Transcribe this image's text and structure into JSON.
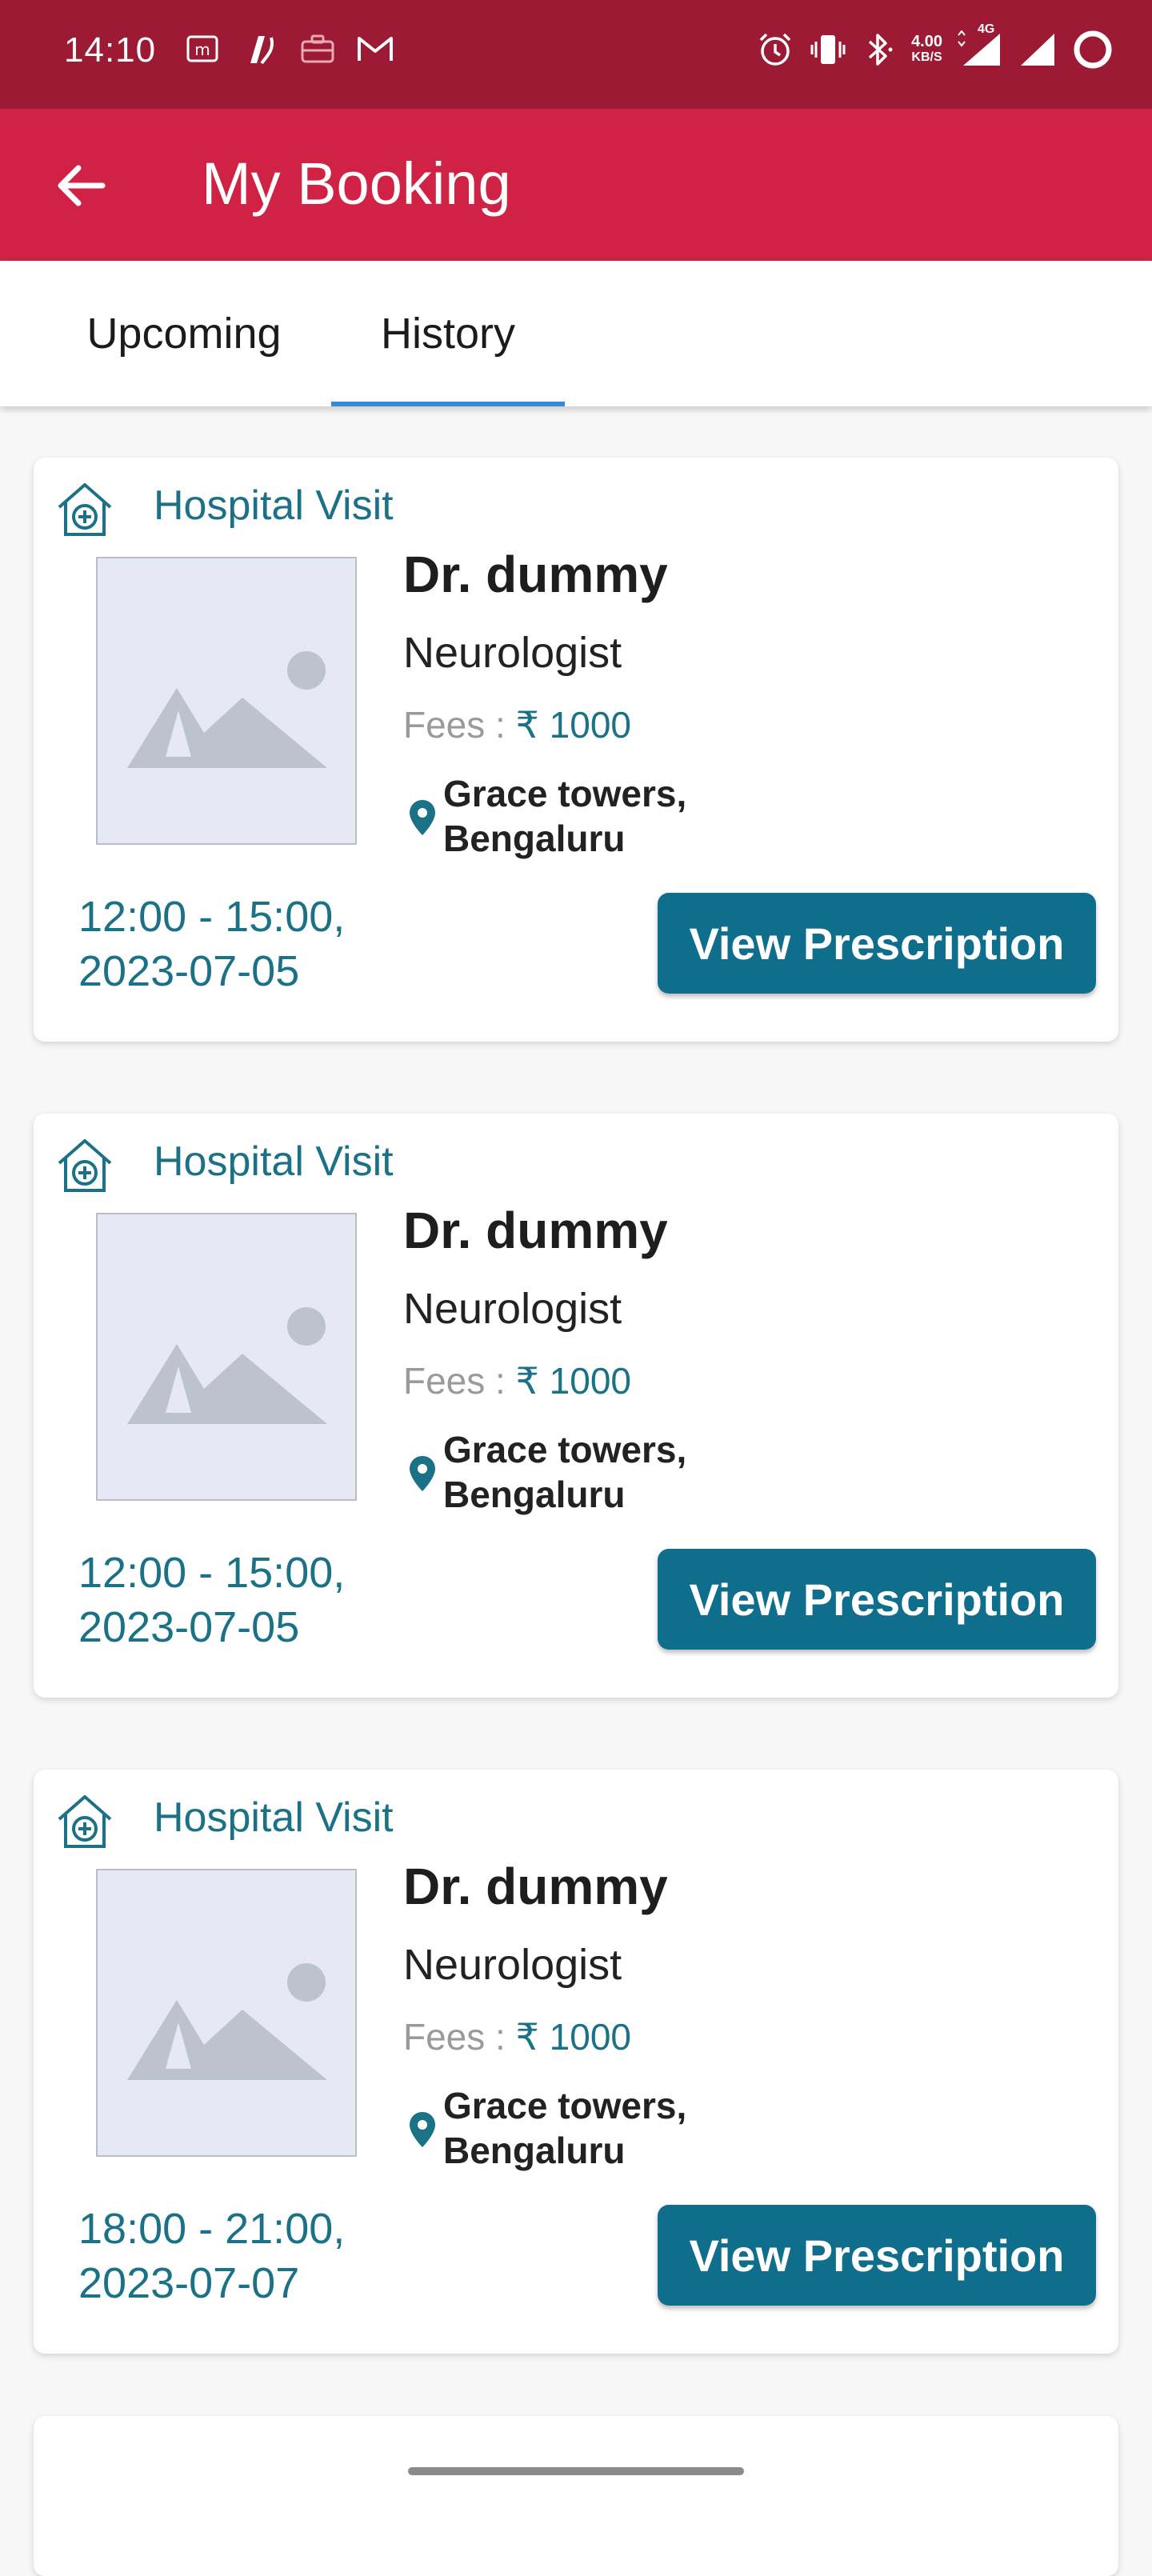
{
  "status_bar": {
    "time": "14:10",
    "left_icons": [
      "m-icon",
      "app-icon",
      "briefcase-icon",
      "gmail-icon"
    ],
    "network_speed_value": "4.00",
    "network_speed_unit": "KB/S",
    "network_type": "4G",
    "right_icons": [
      "alarm-icon",
      "vibrate-icon",
      "bluetooth-icon",
      "signal-icon",
      "signal-icon",
      "battery-icon"
    ]
  },
  "app_bar": {
    "title": "My Booking"
  },
  "tabs": {
    "items": [
      {
        "label": "Upcoming",
        "selected": false
      },
      {
        "label": "History",
        "selected": true
      }
    ],
    "indicator_color": "#3a8ad3"
  },
  "bookings": [
    {
      "visit_type": "Hospital Visit",
      "doctor": "Dr. dummy",
      "specialty": "Neurologist",
      "fees_label": "Fees :",
      "fees_value": "₹ 1000",
      "location_line1": "Grace towers,",
      "location_line2": "Bengaluru",
      "time_range": "12:00 - 15:00,",
      "date": "2023-07-05",
      "button_label": "View Prescription"
    },
    {
      "visit_type": "Hospital Visit",
      "doctor": "Dr. dummy",
      "specialty": "Neurologist",
      "fees_label": "Fees :",
      "fees_value": "₹ 1000",
      "location_line1": "Grace towers,",
      "location_line2": "Bengaluru",
      "time_range": "12:00 - 15:00,",
      "date": "2023-07-05",
      "button_label": "View Prescription"
    },
    {
      "visit_type": "Hospital Visit",
      "doctor": "Dr. dummy",
      "specialty": "Neurologist",
      "fees_label": "Fees :",
      "fees_value": "₹ 1000",
      "location_line1": "Grace towers,",
      "location_line2": "Bengaluru",
      "time_range": "18:00 - 21:00,",
      "date": "2023-07-07",
      "button_label": "View Prescription"
    }
  ],
  "colors": {
    "status_bar": "#9c1a33",
    "app_bar": "#cf2244",
    "accent_teal": "#1b7186",
    "button": "#0f6e8c"
  }
}
